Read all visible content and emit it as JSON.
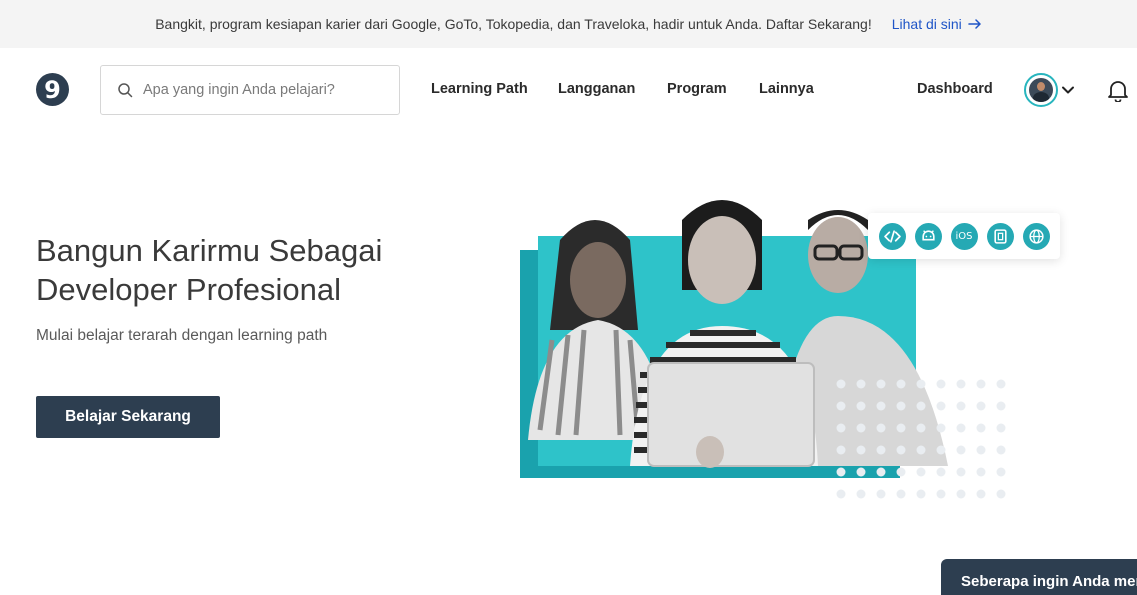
{
  "announcement": {
    "message": "Bangkit, program kesiapan karier dari Google, GoTo, Tokopedia, dan Traveloka, hadir untuk Anda. Daftar Sekarang!",
    "link": "Lihat di sini"
  },
  "nav": {
    "logo_glyph": "9",
    "search_placeholder": "Apa yang ingin Anda pelajari?",
    "items": [
      "Learning Path",
      "Langganan",
      "Program",
      "Lainnya"
    ],
    "dashboard": "Dashboard"
  },
  "hero": {
    "title_line1": "Bangun Karirmu Sebagai",
    "title_line2": "Developer Profesional",
    "subtitle": "Mulai belajar terarah dengan learning path",
    "cta": "Belajar Sekarang"
  },
  "platform_chips": [
    {
      "icon": "code-icon"
    },
    {
      "icon": "android-icon"
    },
    {
      "icon": "ios-icon",
      "label": "iOS"
    },
    {
      "icon": "multiplatform-icon"
    },
    {
      "icon": "web-globe-icon"
    }
  ],
  "survey_tab": "Seberapa ingin Anda mer",
  "colors": {
    "primary_dark": "#2d3e50",
    "accent_teal": "#25a9b4",
    "link_blue": "#1f55c7",
    "banner_bg": "#f4f4f4"
  }
}
